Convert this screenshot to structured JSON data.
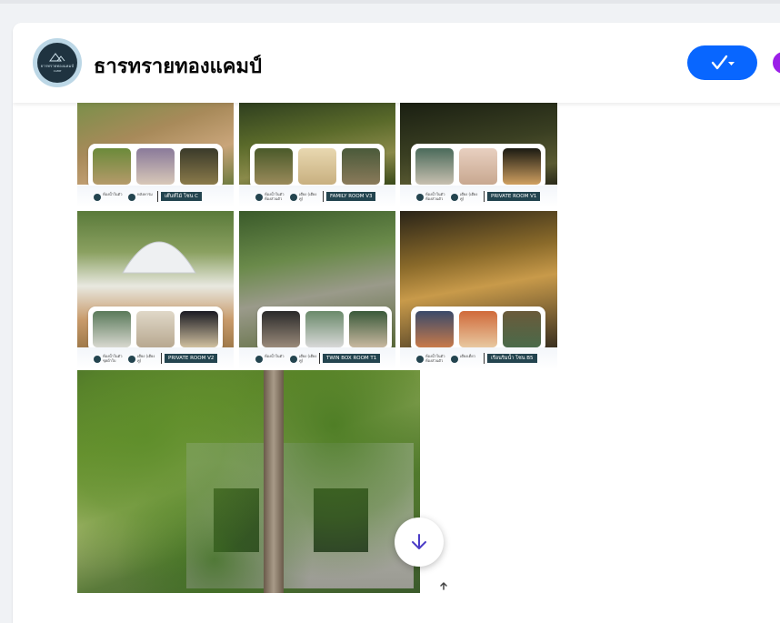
{
  "page": {
    "title": "ธารทรายทองแคมป์",
    "logo_text_line1": "ธารทรายทองแคมป์",
    "logo_text_line2": "CAMP",
    "accent": "#0866ff",
    "follow_icon": "check-dropdown-icon"
  },
  "gallery": {
    "tiles": [
      {
        "tag": "เต๊นท์ไม้ โซน C",
        "info1": "ห้องน้ำในตัว",
        "info2": "หลังคาร่ม"
      },
      {
        "tag": "FAMILY ROOM V3",
        "info1": "ห้องน้ำในตัว ห้องส่วนตัว",
        "info2": "เตียง (เตียงคู่)"
      },
      {
        "tag": "PRIVATE ROOM V1",
        "info1": "ห้องน้ำในตัว ห้องส่วนตัว",
        "info2": "เตียง (เตียงคู่)"
      },
      {
        "tag": "PRIVATE ROOM V2",
        "info1": "ห้องน้ำในตัว ชุดผ้าใบ",
        "info2": "เตียง (เตียงคู่)"
      },
      {
        "tag": "TWIN BOX ROOM T1",
        "info1": "ห้องน้ำในตัว",
        "info2": "เตียง (เตียงคู่)"
      },
      {
        "tag": "เรือนริมน้ำ โซน B5",
        "info1": "ห้องน้ำในตัว ห้องส่วนตัว",
        "info2": "เตียงเดี่ยว"
      }
    ],
    "large_photo": "cabin-in-forest-photo"
  },
  "controls": {
    "scroll_down_icon": "arrow-down-icon",
    "scroll_up_icon": "arrow-up-icon"
  }
}
